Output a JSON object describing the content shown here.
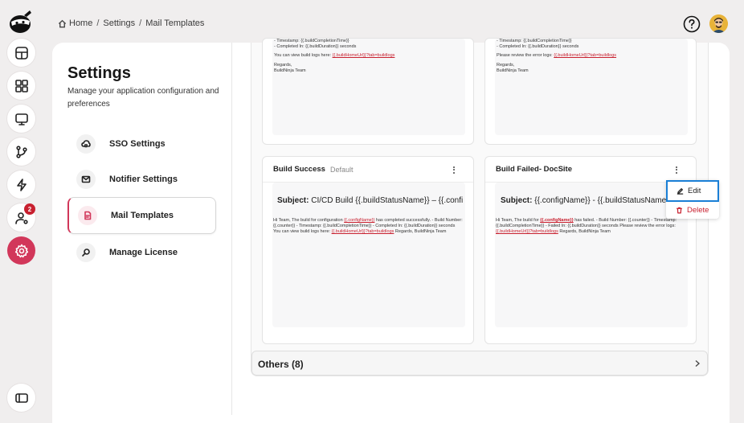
{
  "breadcrumb": {
    "home": "Home",
    "sep": "/",
    "settings": "Settings",
    "current": "Mail Templates"
  },
  "rail": {
    "notification_count": "2",
    "accent": "#d2375a"
  },
  "settings": {
    "title": "Settings",
    "subtitle": "Manage your application configuration and preferences",
    "nav": [
      {
        "label": "SSO Settings",
        "icon": "cloud-lock-icon"
      },
      {
        "label": "Notifier Settings",
        "icon": "mail-icon"
      },
      {
        "label": "Mail Templates",
        "icon": "document-icon",
        "selected": true
      },
      {
        "label": "Manage License",
        "icon": "key-search-icon"
      }
    ]
  },
  "top_cards": [
    {
      "line1": "- Timestamp: {{.buildCompletionTime}}",
      "line2": "- Completed In: {{.buildDuration}} seconds",
      "line3": "You can view build logs here: ",
      "link": "{{.buildHomeUrl}}?tab=buildlogs",
      "line4": "Regards,",
      "line5": "BuildNinja Team"
    },
    {
      "line1": "- Timestamp: {{.buildCompletionTime}}",
      "line2": "- Completed In: {{.buildDuration}} seconds",
      "line3": "Please review the error logs: ",
      "link": "{{.buildHomeUrl}}?tab=buildlogs",
      "line4": "Regards,",
      "line5": "BuildNinja Team"
    }
  ],
  "cards": [
    {
      "title": "Build Success",
      "tag": "Default",
      "subject_label": "Subject:",
      "subject_value": " CI/CD Build {{.buildStatusName}} – {{.confi",
      "body_a": "Hi Team, The build for configuration ",
      "body_config": "{{.configName}}",
      "body_b": " has completed successfully. - Build Number: {{.counter}} - Timestamp: {{.buildCompletionTime}} - Completed In: {{.buildDuration}} seconds You can view build logs here: ",
      "body_link": "{{.buildHomeUrl}}?tab=buildlogs",
      "body_c": " Regards, BuildNinja Team"
    },
    {
      "title": "Build Failed- DocSite",
      "subject_label": "Subject:",
      "subject_value": " {{.configName}} - {{.buildStatusName(stri",
      "body_a": "Hi Team, The build for ",
      "body_config": "{{.configName}}",
      "body_b": " has failed. - Build Number: {{.counter}} - Timestamp: {{.buildCompletionTime}} - Failed In: {{.buildDuration}} seconds Please review the error logs: ",
      "body_link": "{{.buildHomeUrl}}?tab=buildlogs",
      "body_c": " Regards, BuildNinja Team"
    }
  ],
  "menu": {
    "edit": "Edit",
    "delete": "Delete"
  },
  "others": {
    "label": "Others (8)"
  }
}
